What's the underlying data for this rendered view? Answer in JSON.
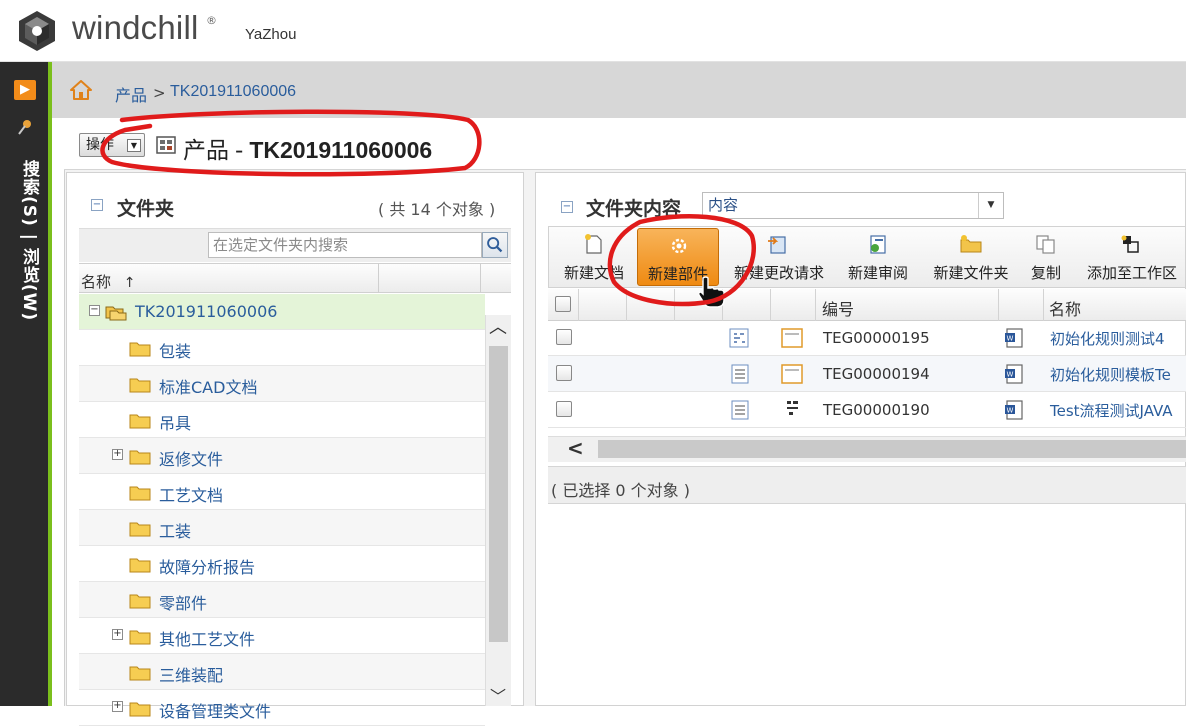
{
  "header": {
    "brand": "windchill",
    "brand_mark": "®",
    "user": "YaZhou"
  },
  "side_nav": {
    "vertical_label": "搜索(S) | 浏览(W)",
    "accent_color": "#7bbf1c",
    "toggle_color": "#f28c1a"
  },
  "breadcrumb": {
    "root": "产品",
    "separator": ">",
    "current": "TK201911060006"
  },
  "title_bar": {
    "actions_label": "操作",
    "type_label": "产品",
    "separator": "-",
    "number": "TK201911060006"
  },
  "folders": {
    "title": "文件夹",
    "count": "( 共 14 个对象 )",
    "search_placeholder": "在选定文件夹内搜索",
    "column_name": "名称",
    "sort_indicator": "↑",
    "items": [
      {
        "label": "TK201911060006",
        "expander": "−"
      },
      {
        "label": "包装",
        "expander": ""
      },
      {
        "label": "标准CAD文档",
        "expander": ""
      },
      {
        "label": "吊具",
        "expander": ""
      },
      {
        "label": "返修文件",
        "expander": "+"
      },
      {
        "label": "工艺文档",
        "expander": ""
      },
      {
        "label": "工装",
        "expander": ""
      },
      {
        "label": "故障分析报告",
        "expander": ""
      },
      {
        "label": "零部件",
        "expander": ""
      },
      {
        "label": "其他工艺文件",
        "expander": "+"
      },
      {
        "label": "三维装配",
        "expander": ""
      },
      {
        "label": "设备管理类文件",
        "expander": "+"
      }
    ]
  },
  "contents": {
    "title": "文件夹内容",
    "view_value": "内容",
    "toolbar": [
      {
        "label": "新建文档",
        "icon": "new-document-icon"
      },
      {
        "label": "新建部件",
        "icon": "new-part-icon"
      },
      {
        "label": "新建更改请求",
        "icon": "new-change-request-icon"
      },
      {
        "label": "新建审阅",
        "icon": "new-review-icon"
      },
      {
        "label": "新建文件夹",
        "icon": "new-folder-icon"
      },
      {
        "label": "复制",
        "icon": "copy-icon"
      },
      {
        "label": "添加至工作区",
        "icon": "add-to-workspace-icon"
      }
    ],
    "columns": {
      "number": "编号",
      "name": "名称"
    },
    "rows": [
      {
        "number": "TEG00000195",
        "name": "初始化规则测试4"
      },
      {
        "number": "TEG00000194",
        "name": "初始化规则模板Te"
      },
      {
        "number": "TEG00000190",
        "name": "Test流程测试JAVA"
      }
    ],
    "selected_count": "( 已选择 0 个对象 )"
  },
  "colors": {
    "link": "#2a5d9c",
    "highlight_button": "#ef8a12",
    "annotation": "#e01b1b",
    "selected_row": "#e4f4d8"
  }
}
